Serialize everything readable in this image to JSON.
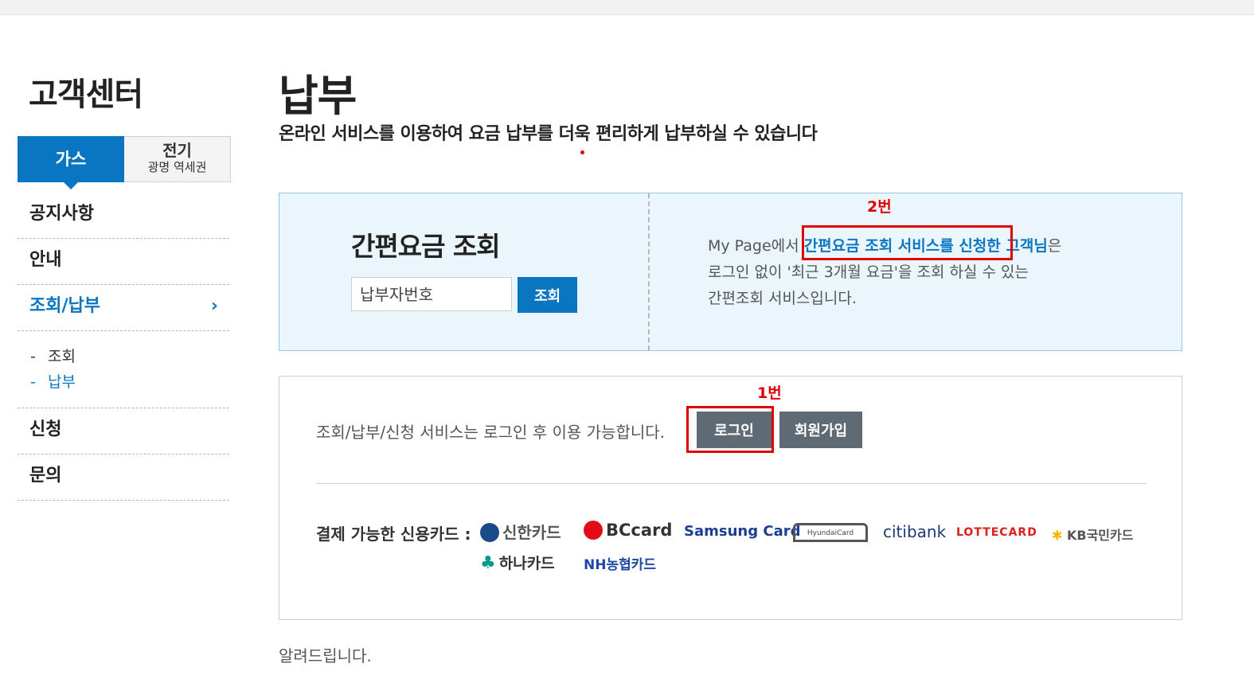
{
  "sidebar": {
    "title": "고객센터",
    "tabs": [
      {
        "label": "가스",
        "active": true
      },
      {
        "label": "전기",
        "sublabel": "광명 역세권",
        "active": false
      }
    ],
    "menu": [
      {
        "label": "공지사항"
      },
      {
        "label": "안내"
      },
      {
        "label": "조회/납부",
        "active": true,
        "icon": "chevron-right-icon"
      },
      {
        "label": "신청"
      },
      {
        "label": "문의"
      }
    ],
    "submenu": [
      {
        "dash": "-",
        "label": "조회",
        "active": false
      },
      {
        "dash": "-",
        "label": "납부",
        "active": true
      }
    ]
  },
  "main": {
    "title": "납부",
    "description": "온라인 서비스를 이용하여 요금 납부를 더욱 편리하게 납부하실 수 있습니다",
    "quick": {
      "title": "간편요금 조회",
      "input_placeholder": "납부자번호",
      "button": "조회",
      "desc_prefix": "My Page에서 ",
      "desc_highlight": "간편요금 조회 서비스를 신청한 고객님",
      "desc_suffix": "은",
      "desc_line2": "로그인 없이 '최근 3개월 요금'을 조회 하실 수 있는",
      "desc_line3": "간편조회 서비스입니다."
    },
    "login": {
      "text": "조회/납부/신청 서비스는 로그인 후 이용 가능합니다.",
      "login_button": "로그인",
      "join_button": "회원가입"
    },
    "cards": {
      "label": "결제 가능한 신용카드 :",
      "items": [
        "신한카드",
        "BCcard",
        "Samsung Card",
        "HyundaiCard",
        "citibank",
        "LOTTECARD",
        "KB국민카드",
        "하나카드",
        "NH농협카드"
      ]
    },
    "notice": "알려드립니다."
  },
  "annotations": [
    {
      "label": "1번",
      "color": "#e00000"
    },
    {
      "label": "2번",
      "color": "#e00000"
    }
  ],
  "colors": {
    "accent": "#0a76c2",
    "gray_button": "#5f6b74",
    "quick_bg": "#eaf5fc",
    "annotation": "#e00000"
  }
}
